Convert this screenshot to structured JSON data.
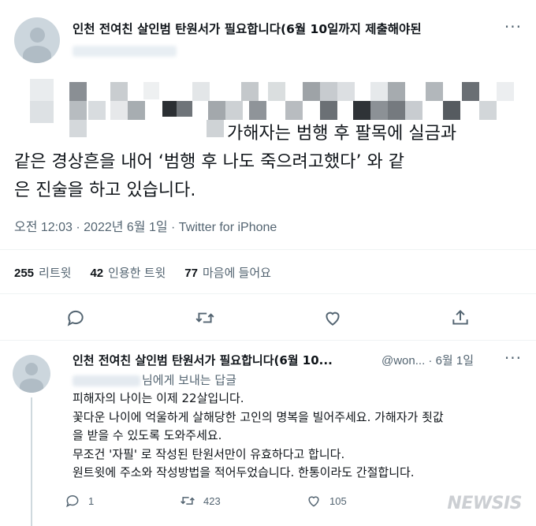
{
  "main_tweet": {
    "display_name": "인천 전여친 살인범 탄원서가 필요합니다(6월 10일까지 제출해야된",
    "more_label": "···",
    "text_lines": [
      "가해자는 범행 후 팔목에 실금과",
      "같은 경상흔을 내어 ‘범행 후 나도 죽으려고했다’ 와 같",
      "은 진술을 하고 있습니다."
    ],
    "meta": "오전 12:03 · 2022년 6월 1일 · Twitter for iPhone",
    "stats": [
      {
        "count": "255",
        "label": "리트윗"
      },
      {
        "count": "42",
        "label": "인용한 트윗"
      },
      {
        "count": "77",
        "label": "마음에 들어요"
      }
    ],
    "actions": [
      "reply-icon",
      "retweet-icon",
      "like-icon",
      "share-icon"
    ]
  },
  "reply_tweet": {
    "display_name": "인천 전여친 살인범 탄원서가 필요합니다(6월 10...",
    "handle_date": "@won... · 6월 1일",
    "more_label": "···",
    "reply_to": "님에게 보내는 답글",
    "body_lines": [
      "피해자의 나이는 이제 22살입니다.",
      "꽃다운 나이에 억울하게 살해당한 고인의 명복을 빌어주세요. 가해자가 죗값",
      "을 받을 수 있도록 도와주세요.",
      "무조건 '자필' 로 작성된 탄원서만이 유효하다고 합니다.",
      "원트윗에 주소와 작성방법을 적어두었습니다. 한통이라도 간절합니다."
    ],
    "reply_count": "1",
    "retweet_count": "423",
    "like_count": "105"
  },
  "watermark": "NEWSIS",
  "colors": {
    "text": "#0f1419",
    "secondary": "#536471",
    "divider": "#eff3f4"
  }
}
